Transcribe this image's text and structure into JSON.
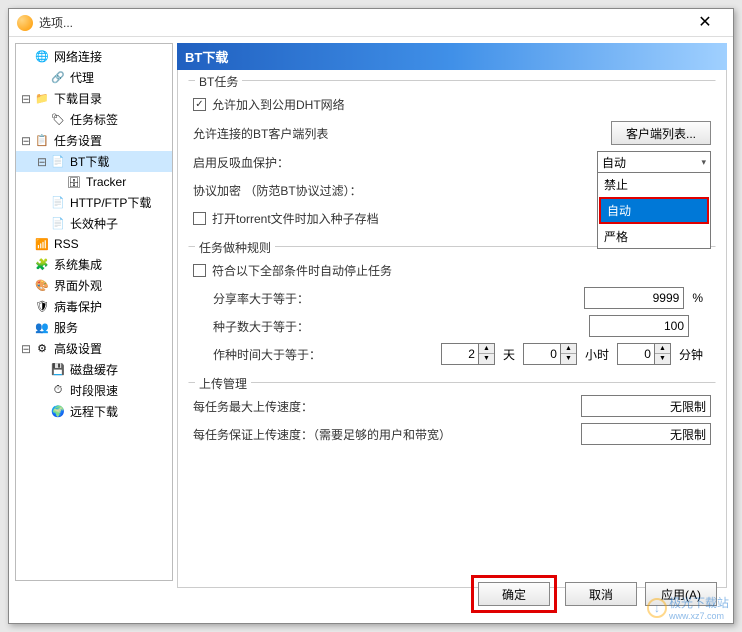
{
  "window": {
    "title": "选项..."
  },
  "sidebar": {
    "items": [
      {
        "label": "网络连接",
        "icon": "🌐",
        "indent": 0,
        "expand": ""
      },
      {
        "label": "代理",
        "icon": "🔗",
        "indent": 1,
        "expand": ""
      },
      {
        "label": "下载目录",
        "icon": "📁",
        "indent": 0,
        "expand": "⊟"
      },
      {
        "label": "任务标签",
        "icon": "🏷",
        "indent": 1,
        "expand": ""
      },
      {
        "label": "任务设置",
        "icon": "📋",
        "indent": 0,
        "expand": "⊟"
      },
      {
        "label": "BT下载",
        "icon": "📄",
        "indent": 1,
        "expand": "⊟",
        "selected": true
      },
      {
        "label": "Tracker",
        "icon": "🗄",
        "indent": 2,
        "expand": ""
      },
      {
        "label": "HTTP/FTP下载",
        "icon": "📄",
        "indent": 1,
        "expand": ""
      },
      {
        "label": "长效种子",
        "icon": "📄",
        "indent": 1,
        "expand": ""
      },
      {
        "label": "RSS",
        "icon": "📶",
        "indent": 0,
        "expand": "",
        "color": "#ff8800"
      },
      {
        "label": "系统集成",
        "icon": "🧩",
        "indent": 0,
        "expand": ""
      },
      {
        "label": "界面外观",
        "icon": "🎨",
        "indent": 0,
        "expand": ""
      },
      {
        "label": "病毒保护",
        "icon": "🛡",
        "indent": 0,
        "expand": ""
      },
      {
        "label": "服务",
        "icon": "👥",
        "indent": 0,
        "expand": ""
      },
      {
        "label": "高级设置",
        "icon": "⚙",
        "indent": 0,
        "expand": "⊟"
      },
      {
        "label": "磁盘缓存",
        "icon": "💾",
        "indent": 1,
        "expand": ""
      },
      {
        "label": "时段限速",
        "icon": "⏱",
        "indent": 1,
        "expand": ""
      },
      {
        "label": "远程下载",
        "icon": "🌍",
        "indent": 1,
        "expand": ""
      }
    ]
  },
  "main": {
    "title": "BT下载",
    "bttask": {
      "legend": "BT任务",
      "dht_checkbox": "允许加入到公用DHT网络",
      "client_list_label": "允许连接的BT客户端列表",
      "client_list_btn": "客户端列表...",
      "leech_label": "启用反吸血保护：",
      "leech_value": "自动",
      "leech_options": [
        "禁止",
        "自动",
        "严格"
      ],
      "encrypt_label": "协议加密 （防范BT协议过滤）：",
      "seed_archive": "打开torrent文件时加入种子存档"
    },
    "seedrule": {
      "legend": "任务做种规则",
      "stop_condition": "符合以下全部条件时自动停止任务",
      "ratio_label": "分享率大于等于：",
      "ratio_value": "9999",
      "ratio_unit": "%",
      "seeds_label": "种子数大于等于：",
      "seeds_value": "100",
      "time_label": "作种时间大于等于：",
      "time_days": "2",
      "time_days_unit": "天",
      "time_hours": "0",
      "time_hours_unit": "小时",
      "time_mins": "0",
      "time_mins_unit": "分钟"
    },
    "upload": {
      "legend": "上传管理",
      "max_up_label": "每任务最大上传速度：",
      "max_up_value": "无限制",
      "guarantee_label": "每任务保证上传速度：（需要足够的用户和带宽）",
      "guarantee_value": "无限制"
    }
  },
  "footer": {
    "ok": "确定",
    "cancel": "取消",
    "apply": "应用(A)"
  },
  "watermark": {
    "text": "极光下载站",
    "url": "www.xz7.com"
  }
}
